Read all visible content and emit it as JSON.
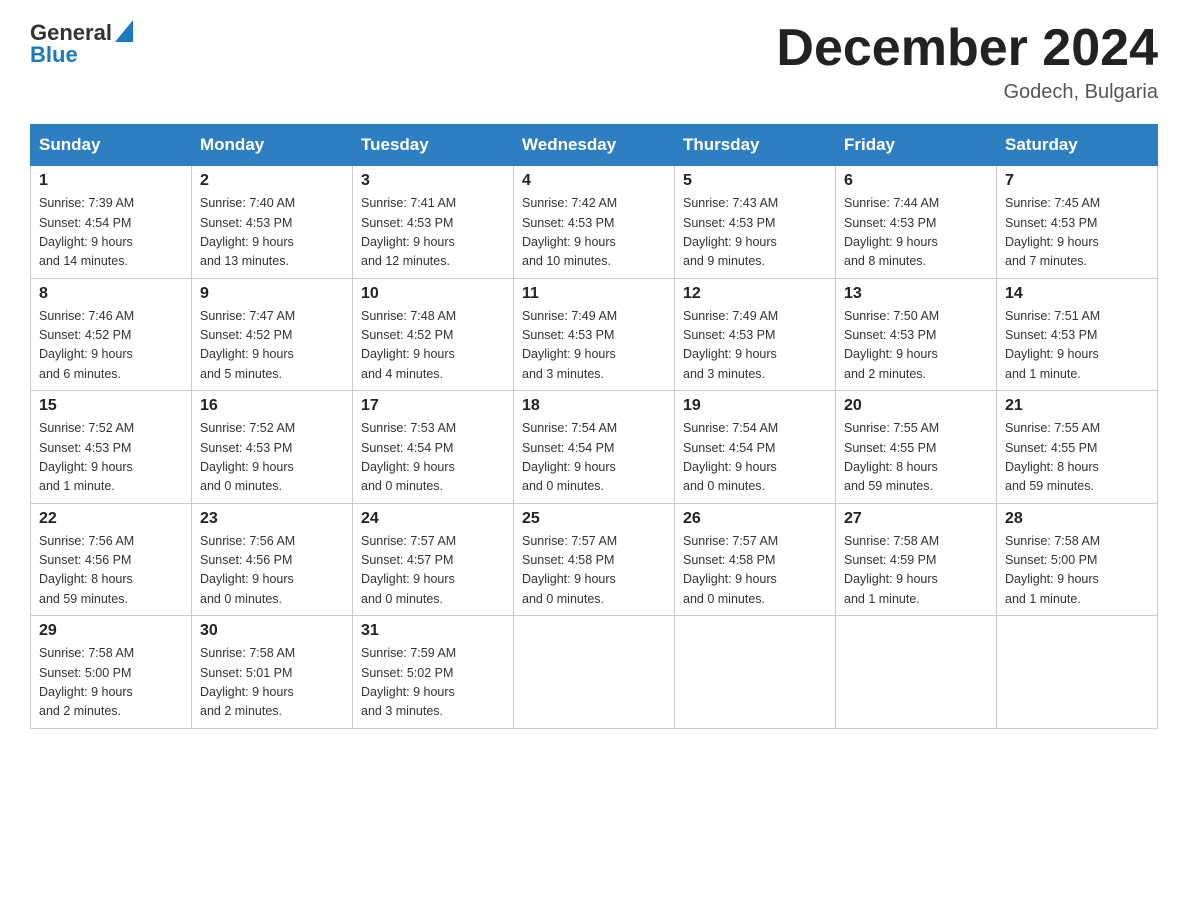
{
  "logo": {
    "general": "General",
    "blue": "Blue"
  },
  "title": "December 2024",
  "location": "Godech, Bulgaria",
  "days_of_week": [
    "Sunday",
    "Monday",
    "Tuesday",
    "Wednesday",
    "Thursday",
    "Friday",
    "Saturday"
  ],
  "weeks": [
    [
      {
        "day": "1",
        "sunrise": "7:39 AM",
        "sunset": "4:54 PM",
        "daylight": "9 hours and 14 minutes."
      },
      {
        "day": "2",
        "sunrise": "7:40 AM",
        "sunset": "4:53 PM",
        "daylight": "9 hours and 13 minutes."
      },
      {
        "day": "3",
        "sunrise": "7:41 AM",
        "sunset": "4:53 PM",
        "daylight": "9 hours and 12 minutes."
      },
      {
        "day": "4",
        "sunrise": "7:42 AM",
        "sunset": "4:53 PM",
        "daylight": "9 hours and 10 minutes."
      },
      {
        "day": "5",
        "sunrise": "7:43 AM",
        "sunset": "4:53 PM",
        "daylight": "9 hours and 9 minutes."
      },
      {
        "day": "6",
        "sunrise": "7:44 AM",
        "sunset": "4:53 PM",
        "daylight": "9 hours and 8 minutes."
      },
      {
        "day": "7",
        "sunrise": "7:45 AM",
        "sunset": "4:53 PM",
        "daylight": "9 hours and 7 minutes."
      }
    ],
    [
      {
        "day": "8",
        "sunrise": "7:46 AM",
        "sunset": "4:52 PM",
        "daylight": "9 hours and 6 minutes."
      },
      {
        "day": "9",
        "sunrise": "7:47 AM",
        "sunset": "4:52 PM",
        "daylight": "9 hours and 5 minutes."
      },
      {
        "day": "10",
        "sunrise": "7:48 AM",
        "sunset": "4:52 PM",
        "daylight": "9 hours and 4 minutes."
      },
      {
        "day": "11",
        "sunrise": "7:49 AM",
        "sunset": "4:53 PM",
        "daylight": "9 hours and 3 minutes."
      },
      {
        "day": "12",
        "sunrise": "7:49 AM",
        "sunset": "4:53 PM",
        "daylight": "9 hours and 3 minutes."
      },
      {
        "day": "13",
        "sunrise": "7:50 AM",
        "sunset": "4:53 PM",
        "daylight": "9 hours and 2 minutes."
      },
      {
        "day": "14",
        "sunrise": "7:51 AM",
        "sunset": "4:53 PM",
        "daylight": "9 hours and 1 minute."
      }
    ],
    [
      {
        "day": "15",
        "sunrise": "7:52 AM",
        "sunset": "4:53 PM",
        "daylight": "9 hours and 1 minute."
      },
      {
        "day": "16",
        "sunrise": "7:52 AM",
        "sunset": "4:53 PM",
        "daylight": "9 hours and 0 minutes."
      },
      {
        "day": "17",
        "sunrise": "7:53 AM",
        "sunset": "4:54 PM",
        "daylight": "9 hours and 0 minutes."
      },
      {
        "day": "18",
        "sunrise": "7:54 AM",
        "sunset": "4:54 PM",
        "daylight": "9 hours and 0 minutes."
      },
      {
        "day": "19",
        "sunrise": "7:54 AM",
        "sunset": "4:54 PM",
        "daylight": "9 hours and 0 minutes."
      },
      {
        "day": "20",
        "sunrise": "7:55 AM",
        "sunset": "4:55 PM",
        "daylight": "8 hours and 59 minutes."
      },
      {
        "day": "21",
        "sunrise": "7:55 AM",
        "sunset": "4:55 PM",
        "daylight": "8 hours and 59 minutes."
      }
    ],
    [
      {
        "day": "22",
        "sunrise": "7:56 AM",
        "sunset": "4:56 PM",
        "daylight": "8 hours and 59 minutes."
      },
      {
        "day": "23",
        "sunrise": "7:56 AM",
        "sunset": "4:56 PM",
        "daylight": "9 hours and 0 minutes."
      },
      {
        "day": "24",
        "sunrise": "7:57 AM",
        "sunset": "4:57 PM",
        "daylight": "9 hours and 0 minutes."
      },
      {
        "day": "25",
        "sunrise": "7:57 AM",
        "sunset": "4:58 PM",
        "daylight": "9 hours and 0 minutes."
      },
      {
        "day": "26",
        "sunrise": "7:57 AM",
        "sunset": "4:58 PM",
        "daylight": "9 hours and 0 minutes."
      },
      {
        "day": "27",
        "sunrise": "7:58 AM",
        "sunset": "4:59 PM",
        "daylight": "9 hours and 1 minute."
      },
      {
        "day": "28",
        "sunrise": "7:58 AM",
        "sunset": "5:00 PM",
        "daylight": "9 hours and 1 minute."
      }
    ],
    [
      {
        "day": "29",
        "sunrise": "7:58 AM",
        "sunset": "5:00 PM",
        "daylight": "9 hours and 2 minutes."
      },
      {
        "day": "30",
        "sunrise": "7:58 AM",
        "sunset": "5:01 PM",
        "daylight": "9 hours and 2 minutes."
      },
      {
        "day": "31",
        "sunrise": "7:59 AM",
        "sunset": "5:02 PM",
        "daylight": "9 hours and 3 minutes."
      },
      null,
      null,
      null,
      null
    ]
  ],
  "labels": {
    "sunrise": "Sunrise:",
    "sunset": "Sunset:",
    "daylight": "Daylight:"
  }
}
